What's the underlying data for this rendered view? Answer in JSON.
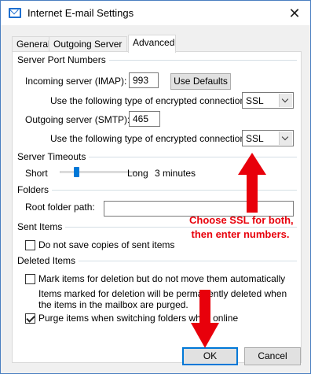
{
  "window": {
    "title": "Internet E-mail Settings",
    "close_glyph": "✕"
  },
  "tabs": [
    {
      "label": "General"
    },
    {
      "label": "Outgoing Server"
    },
    {
      "label": "Advanced"
    }
  ],
  "active_tab": "Advanced",
  "server_ports": {
    "section_title": "Server Port Numbers",
    "incoming_label": "Incoming server (IMAP):",
    "incoming_value": "993",
    "use_defaults_label": "Use Defaults",
    "incoming_encryption_label": "Use the following type of encrypted connection:",
    "incoming_encryption_value": "SSL",
    "outgoing_label": "Outgoing server (SMTP):",
    "outgoing_value": "465",
    "outgoing_encryption_label": "Use the following type of encrypted connection:",
    "outgoing_encryption_value": "SSL"
  },
  "server_timeouts": {
    "section_title": "Server Timeouts",
    "short_label": "Short",
    "long_label": "Long",
    "value_text": "3 minutes",
    "slider_fraction": 0.18
  },
  "folders": {
    "section_title": "Folders",
    "root_label": "Root folder path:",
    "root_value": ""
  },
  "sent_items": {
    "section_title": "Sent Items",
    "no_copies_label": "Do not save copies of sent items",
    "no_copies_checked": false
  },
  "deleted_items": {
    "section_title": "Deleted Items",
    "mark_label": "Mark items for deletion but do not move them automatically",
    "mark_checked": false,
    "info_line1": "Items marked for deletion will be permanently deleted when",
    "info_line2": "the items in the mailbox are purged.",
    "purge_label": "Purge items when switching folders while online",
    "purge_checked": true
  },
  "buttons": {
    "ok_label": "OK",
    "cancel_label": "Cancel"
  },
  "annotation": {
    "line1": "Choose SSL for both,",
    "line2": "then enter numbers.",
    "color": "#e8000b"
  },
  "colors": {
    "accent": "#0078d7",
    "annotation_red": "#e8000b"
  }
}
